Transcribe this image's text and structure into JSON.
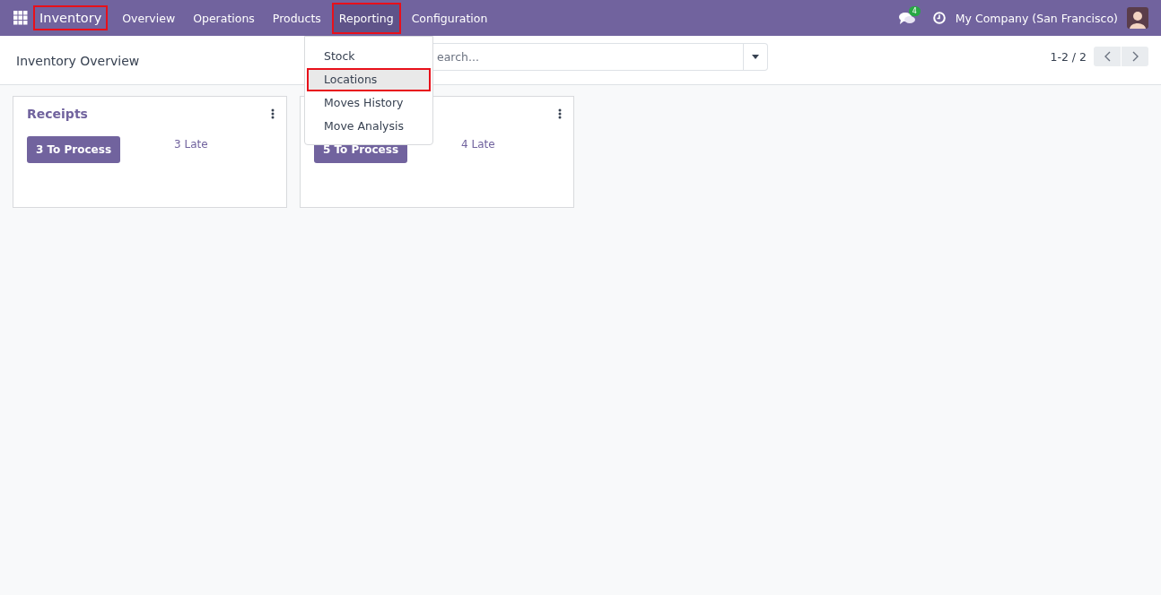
{
  "navbar": {
    "app_name": "Inventory",
    "app_highlighted": true,
    "menu": [
      {
        "label": "Overview",
        "open": false,
        "highlighted": false
      },
      {
        "label": "Operations",
        "open": false,
        "highlighted": false
      },
      {
        "label": "Products",
        "open": false,
        "highlighted": false
      },
      {
        "label": "Reporting",
        "open": true,
        "highlighted": true
      },
      {
        "label": "Configuration",
        "open": false,
        "highlighted": false
      }
    ],
    "message_count": "4",
    "company": "My Company (San Francisco)"
  },
  "dropdown": {
    "items": [
      {
        "label": "Stock",
        "selected": false,
        "highlighted": false
      },
      {
        "label": "Locations",
        "selected": true,
        "highlighted": true
      },
      {
        "label": "Moves History",
        "selected": false,
        "highlighted": false
      },
      {
        "label": "Move Analysis",
        "selected": false,
        "highlighted": false
      }
    ]
  },
  "control_panel": {
    "title": "Inventory Overview",
    "search": {
      "placeholder": "earch..."
    },
    "pager": "1-2 / 2"
  },
  "cards": [
    {
      "title": "Receipts",
      "process_button": "3 To Process",
      "late": "3 Late"
    },
    {
      "process_button": "5 To Process",
      "late": "4 Late"
    }
  ]
}
